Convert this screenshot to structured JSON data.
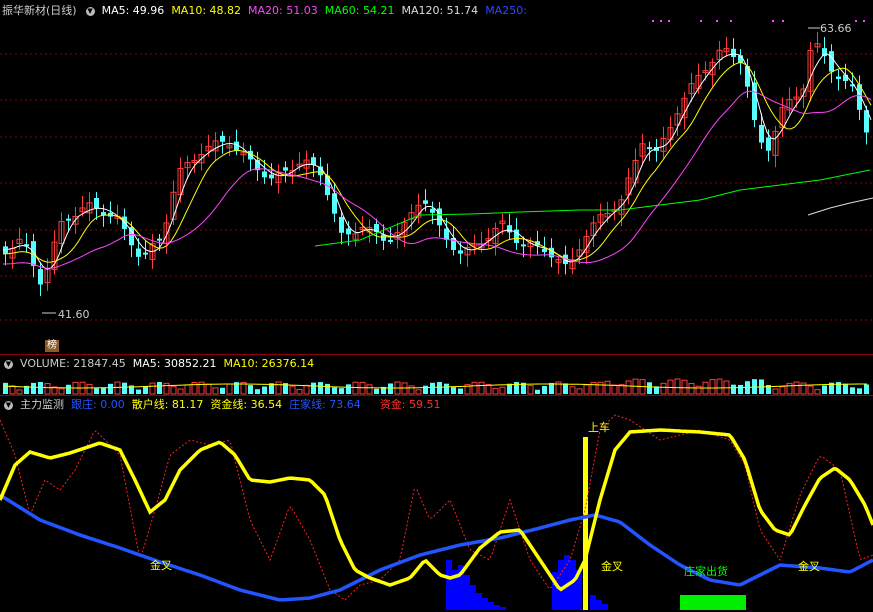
{
  "main_panel": {
    "title": "振华新材(日线)",
    "ma": [
      {
        "label": "MA5: 49.96",
        "color": "#ffffff"
      },
      {
        "label": "MA10: 48.82",
        "color": "#ffff00"
      },
      {
        "label": "MA20: 51.03",
        "color": "#ff44ff"
      },
      {
        "label": "MA60: 54.21",
        "color": "#00ff00"
      },
      {
        "label": "MA120: 51.74",
        "color": "#dddddd"
      },
      {
        "label": "MA250:",
        "color": "#2a4bff"
      }
    ],
    "high_label": "63.66",
    "low_label": "41.60",
    "badge": "榜"
  },
  "volume_panel": {
    "title": "VOLUME: 21847.45",
    "ma5": "MA5: 30852.21",
    "ma10": "MA10: 26376.14"
  },
  "indicator_panel": {
    "title": "主力监测",
    "items": [
      {
        "label": "跟庄: 0.00",
        "color": "#2255ff"
      },
      {
        "label": "散户线: 81.17",
        "color": "#ffff00"
      },
      {
        "label": "资金线: 36.54",
        "color": "#ffff00"
      },
      {
        "label": "庄家线: 73.64",
        "color": "#2255ff"
      },
      {
        "label": "资金: 59.51",
        "color": "#ff3030"
      }
    ],
    "annotations": {
      "shangche": "上车",
      "jincha1": "金叉",
      "jincha2": "金叉",
      "jincha3": "金叉",
      "zhuangjia_chuhuo": "庄家出货"
    }
  },
  "colors": {
    "up": "#ff3b3b",
    "down": "#54ffff",
    "grid": "#8b0000",
    "yellow": "#ffff00",
    "blue": "#2255ff",
    "green": "#00ff00"
  }
}
